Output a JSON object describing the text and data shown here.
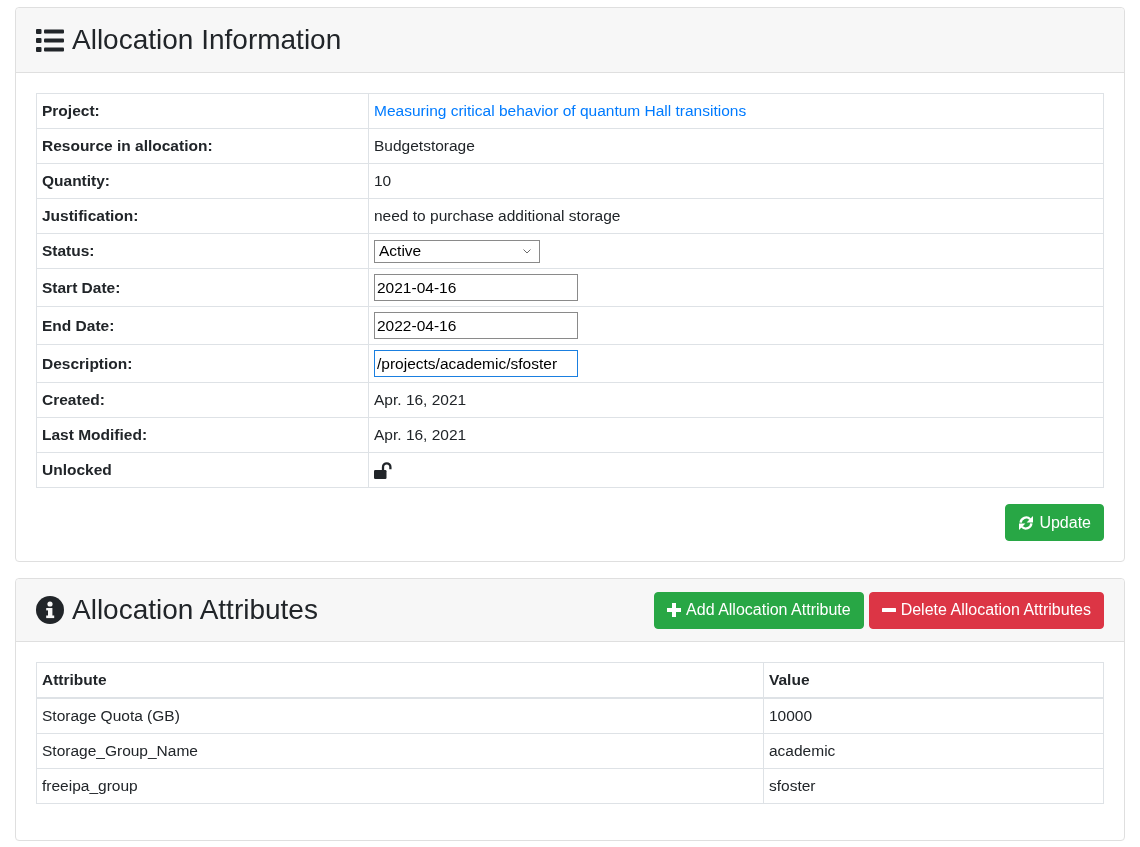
{
  "allocation_information": {
    "title": "Allocation Information",
    "fields": [
      {
        "label": "Project:",
        "kind": "link",
        "value": "Measuring critical behavior of quantum Hall transitions"
      },
      {
        "label": "Resource in allocation:",
        "kind": "text",
        "value": "Budgetstorage"
      },
      {
        "label": "Quantity:",
        "kind": "text",
        "value": "10"
      },
      {
        "label": "Justification:",
        "kind": "text",
        "value": "need to purchase additional storage"
      },
      {
        "label": "Status:",
        "kind": "select",
        "value": "Active",
        "focused": false
      },
      {
        "label": "Start Date:",
        "kind": "input",
        "value": "2021-04-16",
        "focused": false
      },
      {
        "label": "End Date:",
        "kind": "input",
        "value": "2022-04-16",
        "focused": false
      },
      {
        "label": "Description:",
        "kind": "input",
        "value": "/projects/academic/sfoster",
        "focused": true
      },
      {
        "label": "Created:",
        "kind": "text",
        "value": "Apr. 16, 2021"
      },
      {
        "label": "Last Modified:",
        "kind": "text",
        "value": "Apr. 16, 2021"
      },
      {
        "label": "Unlocked",
        "kind": "lock",
        "locked": false
      }
    ],
    "update_button": "Update"
  },
  "allocation_attributes": {
    "title": "Allocation Attributes",
    "buttons": [
      {
        "label": "Add Allocation Attribute",
        "kind": "add"
      },
      {
        "label": "Delete Allocation Attributes",
        "kind": "delete"
      }
    ],
    "table": {
      "columns": [
        "Attribute",
        "Value"
      ],
      "rows": [
        [
          "Storage Quota (GB)",
          "10000"
        ],
        [
          "Storage_Group_Name",
          "academic"
        ],
        [
          "freeipa_group",
          "sfoster"
        ]
      ]
    }
  }
}
